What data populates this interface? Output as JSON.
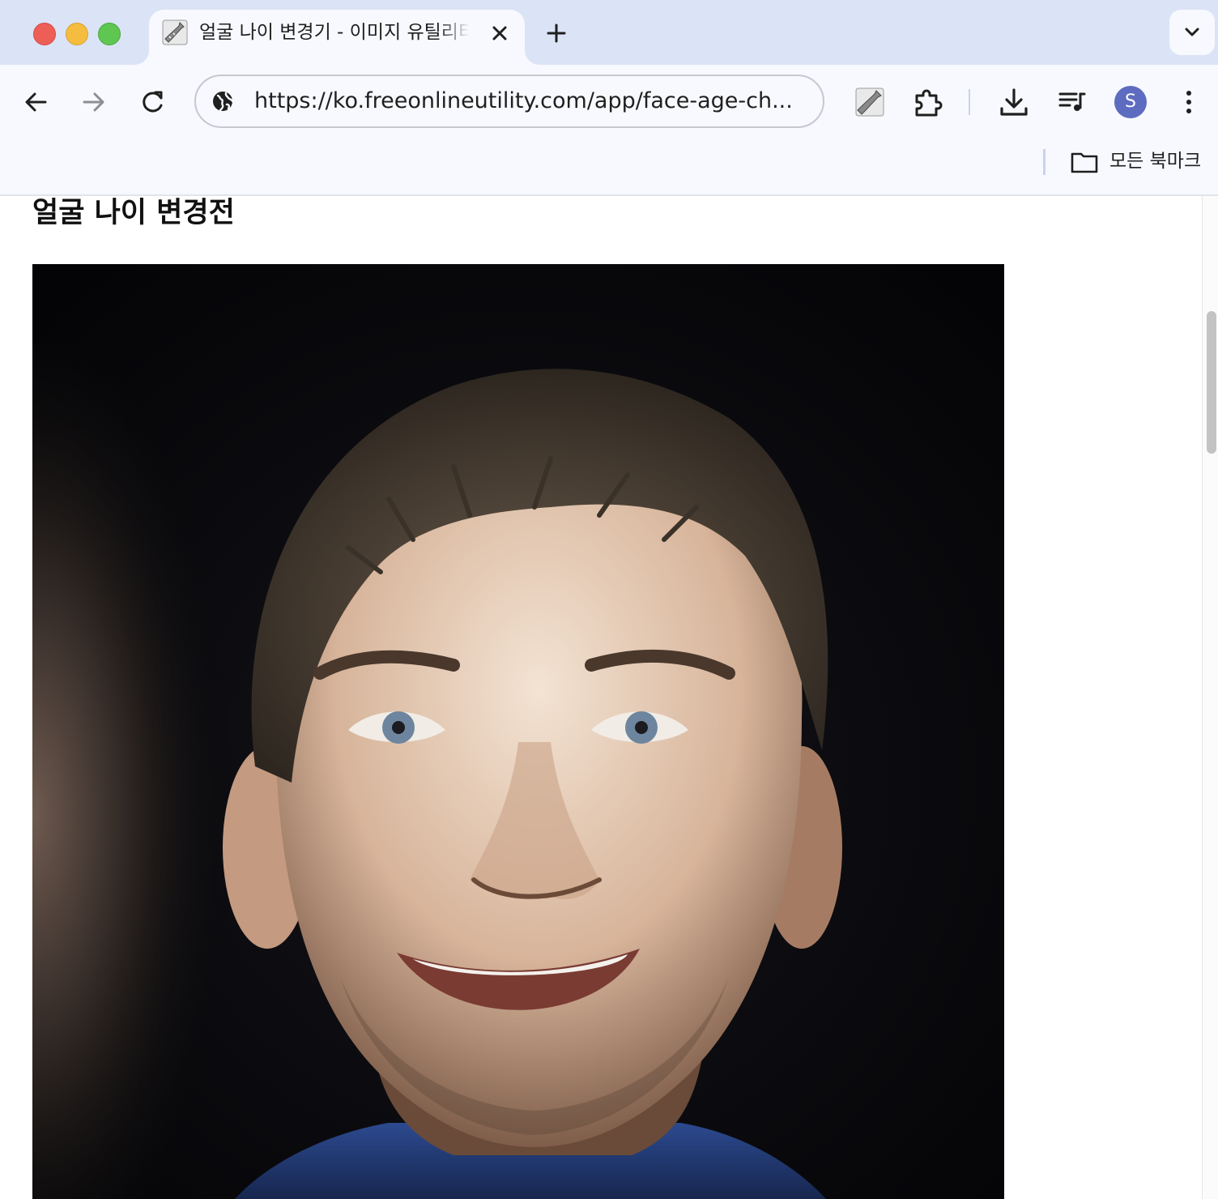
{
  "browser": {
    "tab": {
      "title": "얼굴 나이 변경기 - 이미지 유틸리티",
      "favicon": "wrench-icon",
      "close_icon": "close-icon"
    },
    "new_tab_icon": "plus-icon",
    "tab_search_icon": "chevron-down-icon",
    "toolbar": {
      "back_icon": "arrow-left-icon",
      "forward_icon": "arrow-right-icon",
      "reload_icon": "reload-icon",
      "site_info_icon": "globe-icon",
      "url": "https://ko.freeonlineutility.com/app/face-age-ch...",
      "extension_icon": "wrench-icon",
      "extensions_icon": "puzzle-icon",
      "download_icon": "download-icon",
      "media_icon": "playlist-icon",
      "profile_initial": "S",
      "menu_icon": "kebab-menu-icon"
    },
    "bookmarks_bar": {
      "folder_icon": "folder-icon",
      "all_bookmarks_label": "모든 북마크"
    }
  },
  "page": {
    "heading": "얼굴 나이 변경전",
    "image": "portrait-photo"
  },
  "colors": {
    "tab_strip": "#dbe3f6",
    "toolbar": "#f8f9fe",
    "avatar": "#5d6cc0",
    "photo_background": "#06070a"
  }
}
